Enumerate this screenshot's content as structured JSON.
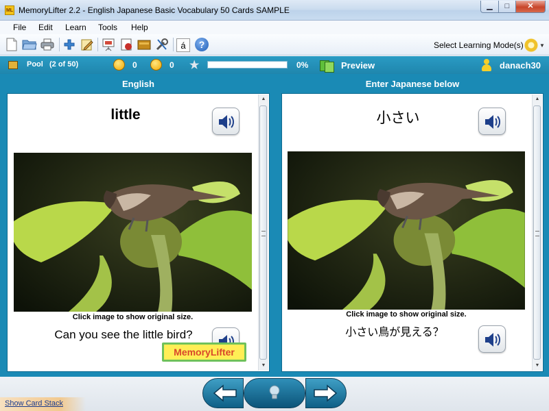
{
  "window": {
    "icon_label": "ML",
    "title": "MemoryLifter 2.2 - English Japanese Basic Vocabulary 50 Cards SAMPLE",
    "min_glyph": "▁",
    "max_glyph": "□",
    "close_glyph": "✕"
  },
  "menu": [
    {
      "label": "File"
    },
    {
      "label": "Edit"
    },
    {
      "label": "Learn"
    },
    {
      "label": "Tools"
    },
    {
      "label": "Help"
    }
  ],
  "toolbar": {
    "icons": [
      "new-document-icon",
      "open-folder-icon",
      "print-icon",
      "add-card-icon",
      "edit-card-icon",
      "slideshow-icon",
      "drill-icon",
      "card-box-icon",
      "tools-icon",
      "character-map-icon",
      "help-icon"
    ],
    "char_button": "á",
    "help_button": "?",
    "mode_label": "Select Learning Mode(s)"
  },
  "status": {
    "pool_label": "Pool",
    "pool_count": "(2 of 50)",
    "right_count": "0",
    "wrong_count": "0",
    "progress": 0,
    "progress_label": "0%",
    "preview_label": "Preview",
    "user": "danach30"
  },
  "left": {
    "title": "English",
    "word": "little",
    "caption": "Click image to show original size.",
    "sentence": "Can you see the little bird?",
    "logo_text": "MemoryLifter"
  },
  "right": {
    "title": "Enter Japanese below",
    "word": "小さい",
    "caption": "Click image to show original size.",
    "sentence": "小さい鳥が見える？"
  },
  "footer": {
    "card_stack_link": "Show Card Stack"
  },
  "colors": {
    "main_blue": "#1a8ab5",
    "status_blue": "#1f86ad"
  }
}
